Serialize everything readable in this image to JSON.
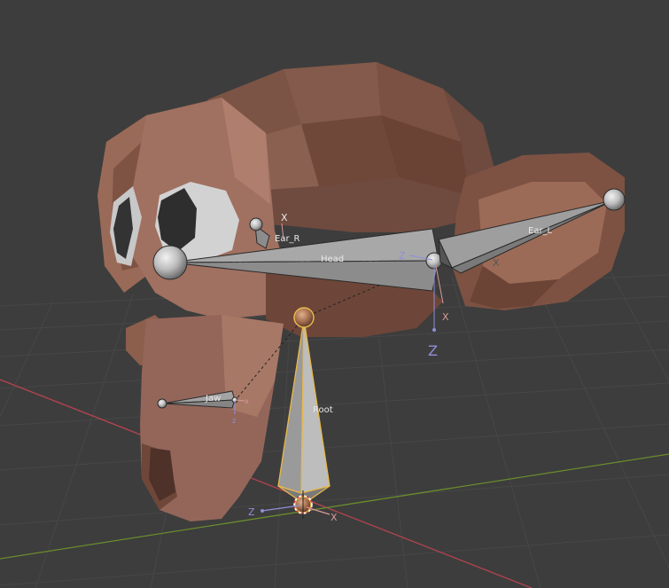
{
  "viewport": {
    "background_color": "#3d3d3d",
    "grid_color": "#474747"
  },
  "axes": {
    "x_axis_color": "#b4434f",
    "y_axis_color": "#6a8c2c",
    "z_label_color": "#8f8fd8",
    "x_label_color": "#d89a9a"
  },
  "bones": {
    "head": {
      "name": "Head",
      "selected": false
    },
    "ear_r": {
      "name": "Ear_R",
      "selected": false
    },
    "ear_l": {
      "name": "Ear_L",
      "selected": false
    },
    "jaw": {
      "name": "Jaw",
      "selected": false
    },
    "root": {
      "name": "Root",
      "selected": true,
      "highlight_color": "#e8b84a"
    }
  },
  "gizmo_labels": {
    "ear_r_x": "X",
    "head_z": "Z",
    "head_tail_x": "X",
    "head_tail_big_z": "Z",
    "ear_l_x": "X",
    "jaw_x": "x",
    "jaw_z": "z",
    "root_z": "Z",
    "root_x": "X"
  },
  "mesh": {
    "name_icon": "suzanne-monkey-mesh",
    "color": "#8c6455"
  }
}
